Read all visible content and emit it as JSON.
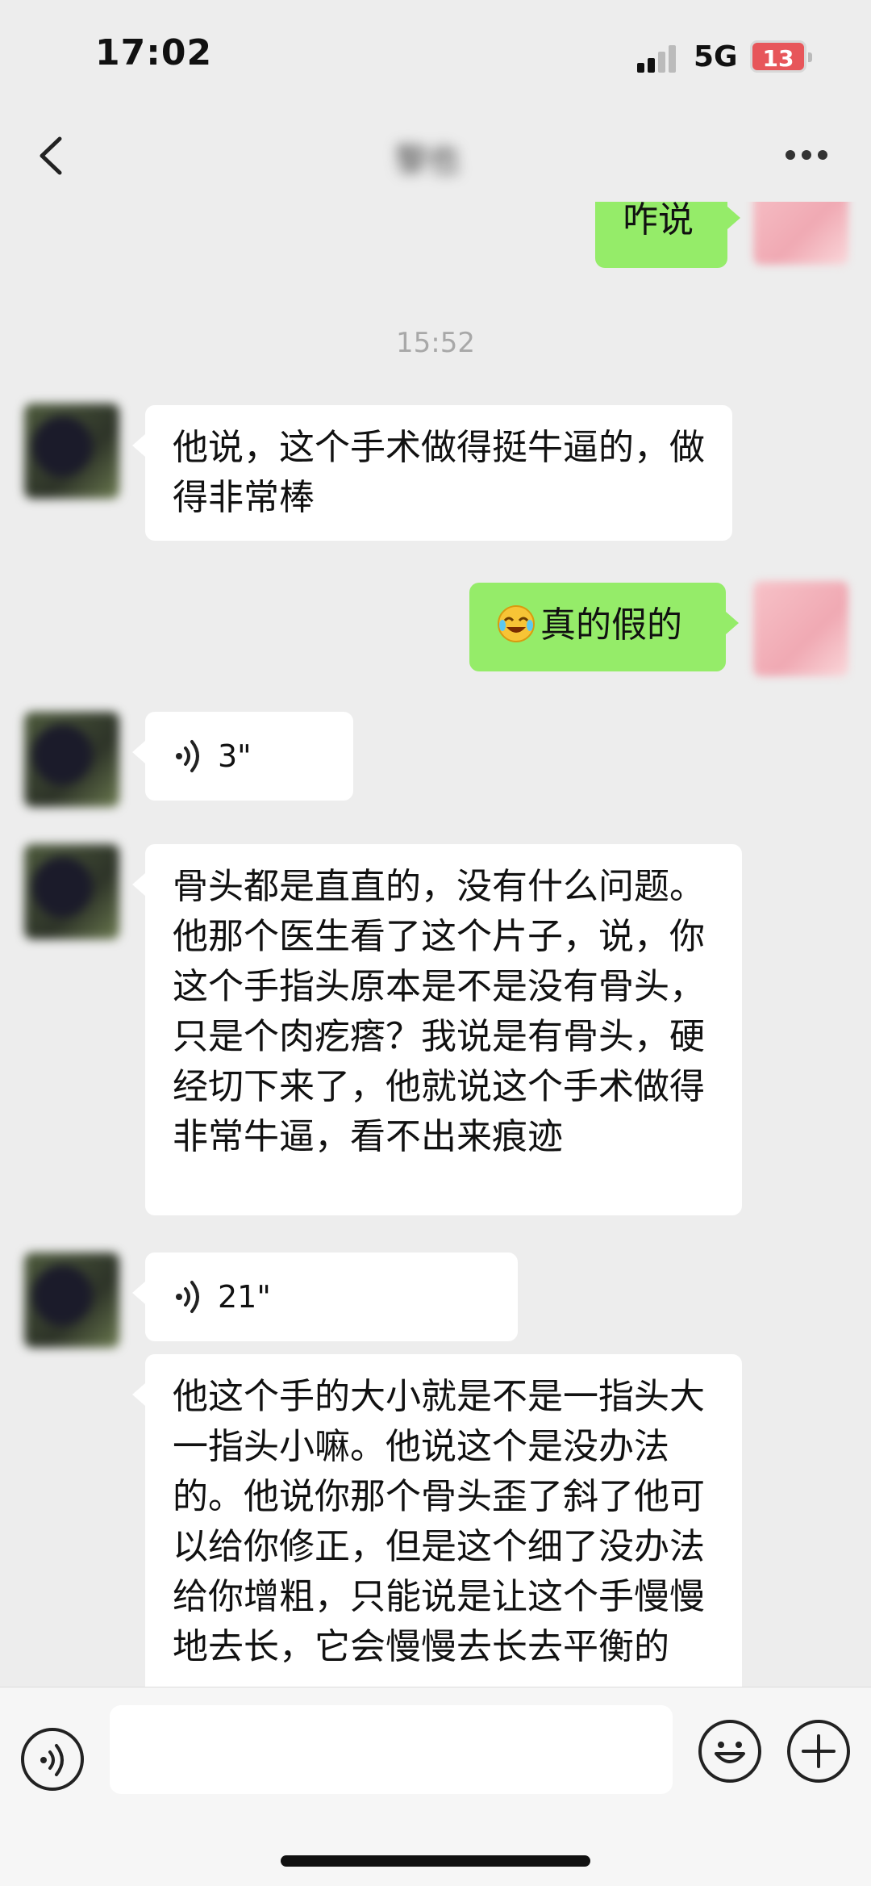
{
  "status_bar": {
    "time": "17:02",
    "network": "5G",
    "battery": "13"
  },
  "nav": {
    "title": "黎也"
  },
  "colors": {
    "outgoing_bubble": "#95ec69",
    "incoming_bubble": "#ffffff",
    "background": "#ededed"
  },
  "messages": [
    {
      "type": "text",
      "direction": "out",
      "text": "咋说"
    },
    {
      "type": "timestamp",
      "text": "15:52"
    },
    {
      "type": "text",
      "direction": "in",
      "text": "他说，这个手术做得挺牛逼的，做得非常棒"
    },
    {
      "type": "text",
      "direction": "out",
      "emoji": "crying-laughing",
      "text": "真的假的"
    },
    {
      "type": "voice",
      "direction": "in",
      "duration": "3\""
    },
    {
      "type": "text",
      "direction": "in",
      "text": "骨头都是直直的，没有什么问题。他那个医生看了这个片子，说，你这个手指头原本是不是没有骨头，只是个肉疙瘩？我说是有骨头，硬经切下来了，他就说这个手术做得非常牛逼，看不出来痕迹"
    },
    {
      "type": "voice",
      "direction": "in",
      "duration": "21\""
    },
    {
      "type": "text",
      "direction": "in",
      "text": "他这个手的大小就是不是一指头大一指头小嘛。他说这个是没办法的。他说你那个骨头歪了斜了他可以给你修正，但是这个细了没办法给你增粗，只能说是让这个手慢慢地去长，它会慢慢去长去平衡的"
    }
  ],
  "input_bar": {
    "placeholder": ""
  }
}
